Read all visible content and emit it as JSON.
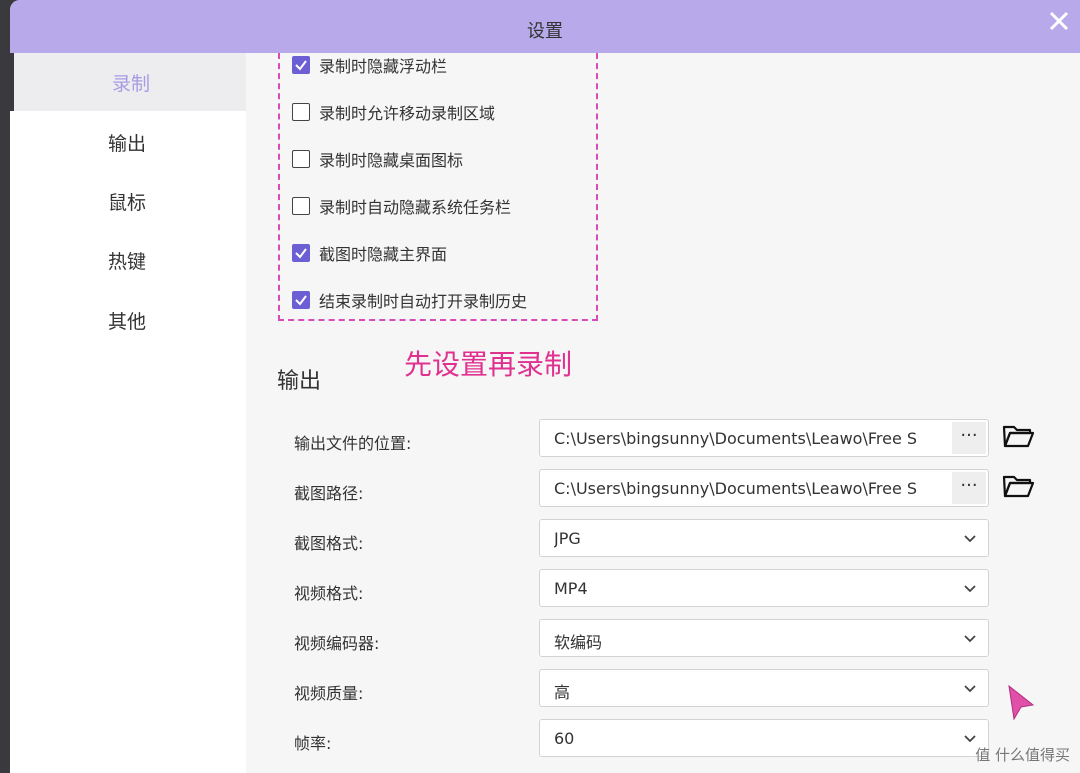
{
  "window": {
    "title": "设置"
  },
  "sidebar": {
    "items": [
      {
        "label": "录制",
        "active": true
      },
      {
        "label": "输出",
        "active": false
      },
      {
        "label": "鼠标",
        "active": false
      },
      {
        "label": "热键",
        "active": false
      },
      {
        "label": "其他",
        "active": false
      }
    ]
  },
  "record_options": [
    {
      "label": "录制时隐藏浮动栏",
      "checked": true
    },
    {
      "label": "录制时允许移动录制区域",
      "checked": false
    },
    {
      "label": "录制时隐藏桌面图标",
      "checked": false
    },
    {
      "label": "录制时自动隐藏系统任务栏",
      "checked": false
    },
    {
      "label": "截图时隐藏主界面",
      "checked": true
    },
    {
      "label": "结束录制时自动打开录制历史",
      "checked": true
    }
  ],
  "annotation": "先设置再录制",
  "output": {
    "section_title": "输出",
    "fields": [
      {
        "label": "输出文件的位置:",
        "value": "C:\\Users\\bingsunny\\Documents\\Leawo\\Free S",
        "type": "path",
        "button": "···"
      },
      {
        "label": "截图路径:",
        "value": "C:\\Users\\bingsunny\\Documents\\Leawo\\Free S",
        "type": "path",
        "button": "···"
      },
      {
        "label": "截图格式:",
        "value": "JPG",
        "type": "select"
      },
      {
        "label": "视频格式:",
        "value": "MP4",
        "type": "select"
      },
      {
        "label": "视频编码器:",
        "value": "软编码",
        "type": "select"
      },
      {
        "label": "视频质量:",
        "value": "高",
        "type": "select"
      },
      {
        "label": "帧率:",
        "value": "60",
        "type": "select"
      }
    ]
  },
  "watermark": "值 什么值得买",
  "colors": {
    "titlebar": "#b7a9ea",
    "accent": "#6c5fd4",
    "annotation": "#e0318f",
    "active_nav": "#a99be3"
  }
}
